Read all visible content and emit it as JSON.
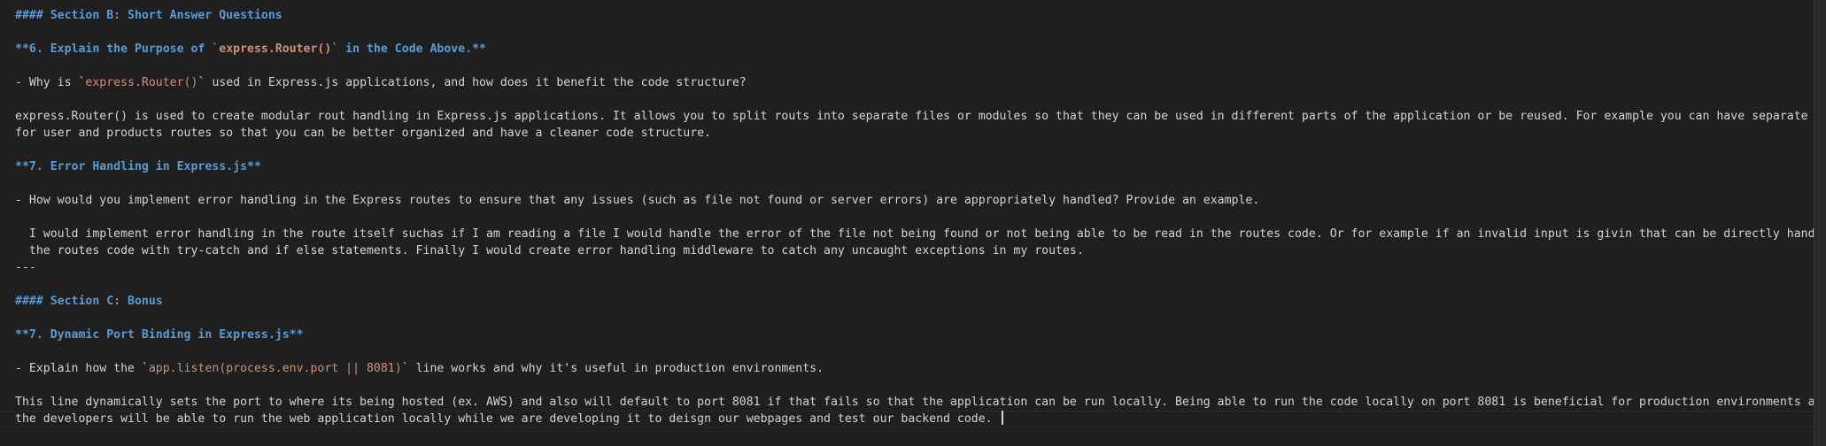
{
  "doc": {
    "l1": "#### Section B: Short Answer Questions",
    "l2_pre": "**6. Explain the Purpose of `",
    "l2_code": "express.Router()",
    "l2_post": "` in the Code Above.**",
    "l3_pre": "- Why is `",
    "l3_code": "express.Router()",
    "l3_post": "` used in Express.js applications, and how does it benefit the code structure?",
    "l4": "express.Router() is used to create modular rout handling in Express.js applications. It allows you to split routs into separate files or modules so that they can be used in different parts of the application or be reused. For example you can have separate files",
    "l5": "for user and products routes so that you can be better organized and have a cleaner code structure.",
    "l6": "**7. Error Handling in Express.js**",
    "l7": "- How would you implement error handling in the Express routes to ensure that any issues (such as file not found or server errors) are appropriately handled? Provide an example.",
    "l8": "  I would implement error handling in the route itself suchas if I am reading a file I would handle the error of the file not being found or not being able to be read in the routes code. Or for example if an invalid input is givin that can be directly handled in",
    "l9": "  the routes code with try-catch and if else statements. Finally I would create error handling middleware to catch any uncaught exceptions in my routes.",
    "l10": "---",
    "l11": "#### Section C: Bonus",
    "l12": "**7. Dynamic Port Binding in Express.js**",
    "l13_pre": "- Explain how the `",
    "l13_code": "app.listen(process.env.port || 8081)",
    "l13_post": "` line works and why it's useful in production environments.",
    "l14": "This line dynamically sets the port to where its being hosted (ex. AWS) and also will default to port 8081 if that fails so that the application can be run locally. Being able to run the code locally on port 8081 is beneficial for production environments as we as",
    "l15": "the developers will be able to run the web application locally while we are developing it to deisgn our webpages and test our backend code. "
  }
}
